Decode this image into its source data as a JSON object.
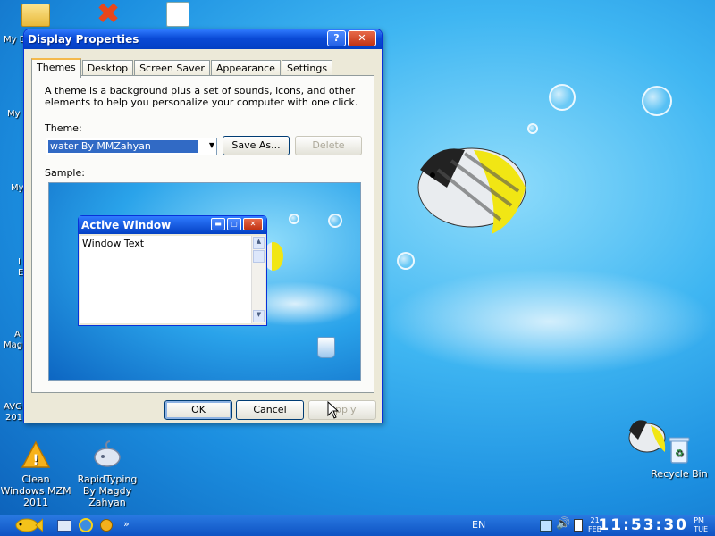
{
  "desktop": {
    "icons": [
      {
        "label": "Clean Windows MZM 2011",
        "icon": "warning-triangle-icon"
      },
      {
        "label": "RapidTyping By Magdy Zahyan",
        "icon": "typing-mouse-icon"
      },
      {
        "label": "Recycle Bin",
        "icon": "recycle-bin-icon"
      }
    ],
    "partial_labels": [
      "My D",
      "My",
      "My",
      "I",
      "E",
      "A",
      "Mag",
      "AVG",
      "201"
    ]
  },
  "window": {
    "title": "Display Properties",
    "help_glyph": "?",
    "close_glyph": "✕",
    "tabs": [
      "Themes",
      "Desktop",
      "Screen Saver",
      "Appearance",
      "Settings"
    ],
    "description": "A theme is a background plus a set of sounds, icons, and other elements to help you personalize your computer with one click.",
    "theme_label": "Theme:",
    "theme_value": "water By MMZahyan",
    "save_as_label": "Save As...",
    "delete_label": "Delete",
    "sample_label": "Sample:",
    "preview": {
      "title": "Active Window",
      "body_text": "Window Text"
    },
    "buttons": {
      "ok": "OK",
      "cancel": "Cancel",
      "apply": "Apply"
    }
  },
  "taskbar": {
    "language": "EN",
    "show_more": "»",
    "date_day": "21",
    "date_month": "FEB",
    "clock": "11:53:30",
    "ampm": "PM",
    "weekday": "TUE"
  },
  "colors": {
    "title_blue": "#0a4ad6",
    "close_red": "#c23414",
    "selection_blue": "#316ac5",
    "active_tab_accent": "#f4b94b"
  }
}
